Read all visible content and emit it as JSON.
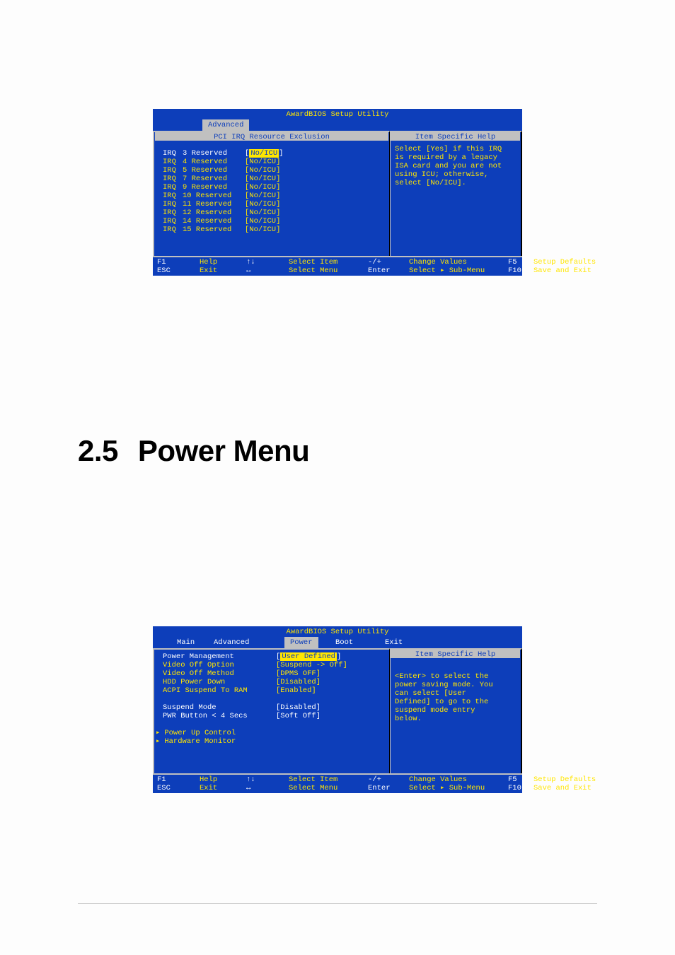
{
  "bios1": {
    "title": "AwardBIOS Setup Utility",
    "tabs": {
      "advanced": "Advanced"
    },
    "panelTitleLeft": "PCI IRQ Resource Exclusion",
    "panelTitleRight": "Item Specific Help",
    "irq": [
      {
        "label_a": "IRQ",
        "label_b": "3 Reserved",
        "value": "[No/ICU]",
        "active": true
      },
      {
        "label_a": "IRQ",
        "label_b": "4 Reserved",
        "value": "[No/ICU]"
      },
      {
        "label_a": "IRQ",
        "label_b": "5 Reserved",
        "value": "[No/ICU]"
      },
      {
        "label_a": "IRQ",
        "label_b": "7 Reserved",
        "value": "[No/ICU]"
      },
      {
        "label_a": "IRQ",
        "label_b": "9 Reserved",
        "value": "[No/ICU]"
      },
      {
        "label_a": "IRQ",
        "label_b": "10 Reserved",
        "value": "[No/ICU]"
      },
      {
        "label_a": "IRQ",
        "label_b": "11 Reserved",
        "value": "[No/ICU]"
      },
      {
        "label_a": "IRQ",
        "label_b": "12 Reserved",
        "value": "[No/ICU]"
      },
      {
        "label_a": "IRQ",
        "label_b": "14 Reserved",
        "value": "[No/ICU]"
      },
      {
        "label_a": "IRQ",
        "label_b": "15 Reserved",
        "value": "[No/ICU]"
      }
    ],
    "help": [
      "Select [Yes] if this IRQ",
      "is required by a legacy",
      "ISA card and you are not",
      "using ICU; otherwise,",
      "select [No/ICU]."
    ],
    "footer": {
      "row1": {
        "k1": "F1",
        "t1": "Help",
        "k2": "↑↓",
        "t2": "Select Item",
        "k3": "-/+",
        "t3": "Change Values",
        "k4": "F5",
        "t4": "Setup Defaults"
      },
      "row2": {
        "k1": "ESC",
        "t1": "Exit",
        "k2": "↔",
        "t2": "Select Menu",
        "k3": "Enter",
        "t3": "Select ▸ Sub-Menu",
        "k4": "F10",
        "t4": "Save and Exit"
      }
    }
  },
  "heading": {
    "num": "2.5",
    "title": "Power Menu"
  },
  "bios2": {
    "title": "AwardBIOS Setup Utility",
    "tabs": {
      "main": "Main",
      "advanced": "Advanced",
      "power": "Power",
      "boot": "Boot",
      "exit": "Exit"
    },
    "panelTitleRight": "Item Specific Help",
    "rows": [
      {
        "label": "Power Management",
        "value": "[User Defined]",
        "active": true
      },
      {
        "label": "Video Off Option",
        "value": "[Suspend -> Off]"
      },
      {
        "label": "Video Off Method",
        "value": "[DPMS OFF]"
      },
      {
        "label": "HDD Power Down",
        "value": "[Disabled]"
      },
      {
        "label": "ACPI Suspend To RAM",
        "value": "[Enabled]"
      },
      {
        "spacer": true
      },
      {
        "label": "Suspend Mode",
        "value": "[Disabled]",
        "white": true
      },
      {
        "label": "PWR Button < 4 Secs",
        "value": "[Soft Off]",
        "white": true
      },
      {
        "spacer": true
      },
      {
        "submenu": true,
        "label": "Power Up Control"
      },
      {
        "submenu": true,
        "label": "Hardware Monitor"
      }
    ],
    "help": [
      "<Enter> to select the",
      "power saving mode. You",
      "can select [User",
      "Defined] to go to the",
      "suspend mode entry",
      "below."
    ],
    "footer": {
      "row1": {
        "k1": "F1",
        "t1": "Help",
        "k2": "↑↓",
        "t2": "Select Item",
        "k3": "-/+",
        "t3": "Change Values",
        "k4": "F5",
        "t4": "Setup Defaults"
      },
      "row2": {
        "k1": "ESC",
        "t1": "Exit",
        "k2": "↔",
        "t2": "Select Menu",
        "k3": "Enter",
        "t3": "Select ▸ Sub-Menu",
        "k4": "F10",
        "t4": "Save and Exit"
      }
    }
  }
}
